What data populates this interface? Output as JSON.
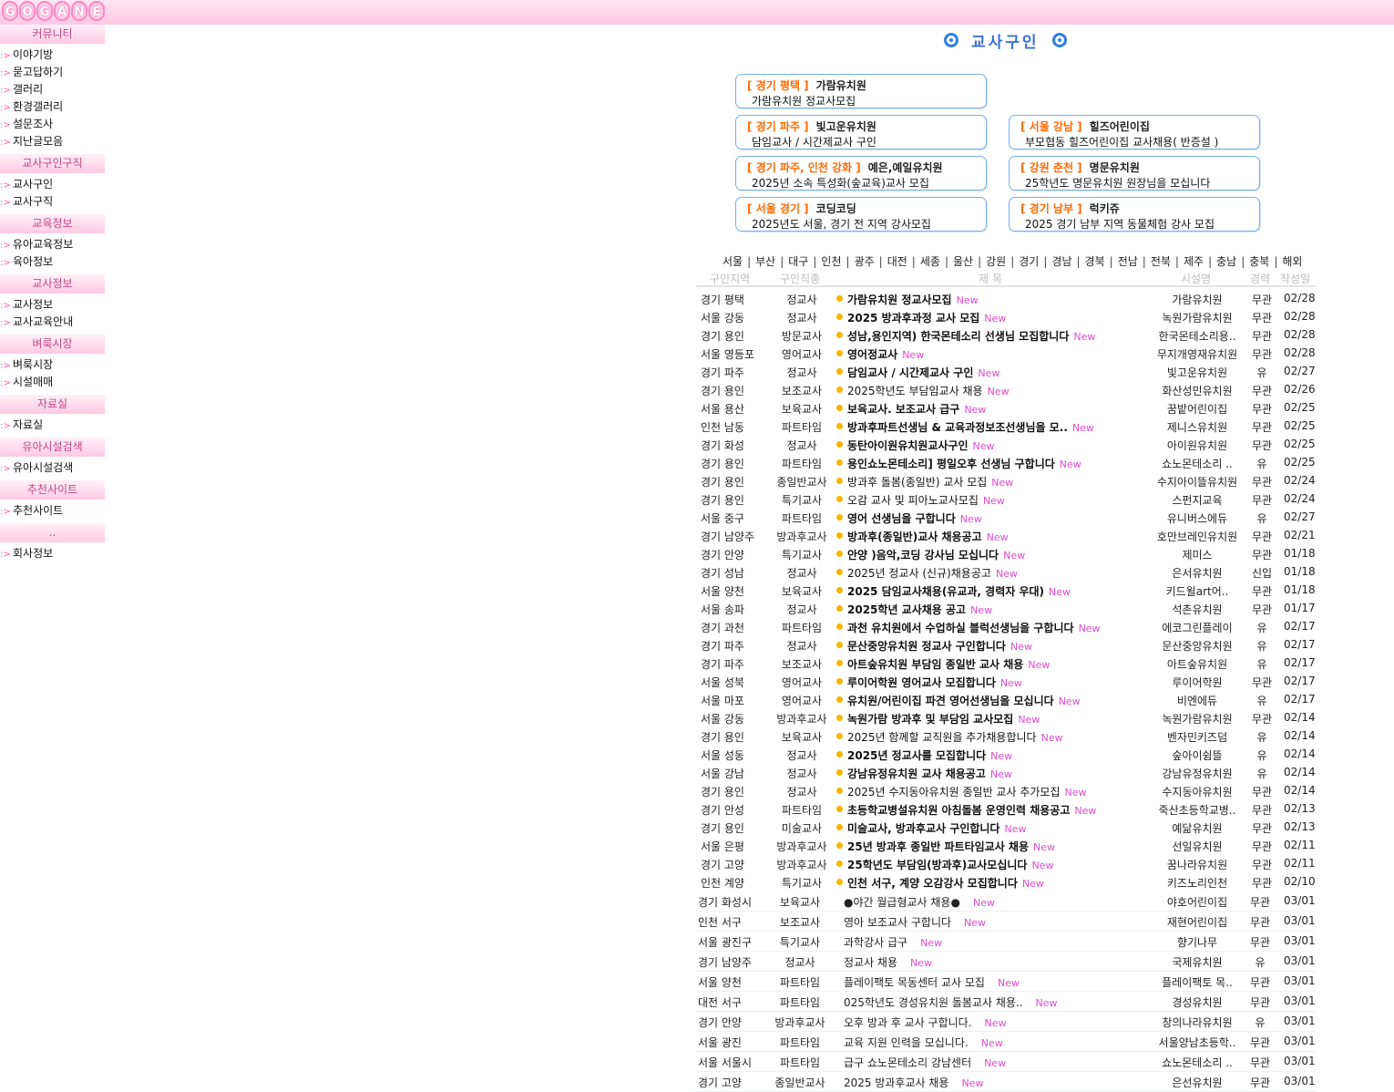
{
  "logo": {
    "letters": [
      "G",
      "O",
      "G",
      "A",
      "N",
      "E"
    ]
  },
  "sidebar": {
    "sections": [
      {
        "title": "커뮤니티",
        "items": [
          "이야기방",
          "묻고답하기",
          "갤러리",
          "환경갤러리",
          "설문조사",
          "지난글모음"
        ]
      },
      {
        "title": "교사구인구직",
        "items": [
          "교사구인",
          "교사구직"
        ]
      },
      {
        "title": "교육정보",
        "items": [
          "유아교육정보",
          "육아정보"
        ]
      },
      {
        "title": "교사정보",
        "items": [
          "교사정보",
          "교사교육안내"
        ]
      },
      {
        "title": "벼룩시장",
        "items": [
          "벼룩시장",
          "시설매매"
        ]
      },
      {
        "title": "자료실",
        "items": [
          "자료실"
        ]
      },
      {
        "title": "유아시설검색",
        "items": [
          "유아시설검색"
        ]
      },
      {
        "title": "추천사이트",
        "items": [
          "추천사이트"
        ]
      },
      {
        "title": "..",
        "items": [
          "회사정보"
        ]
      }
    ],
    "arrow": ":>"
  },
  "board": {
    "title": "교사구인"
  },
  "featured": [
    {
      "region": "[ 경기 평택 ]",
      "name": "가람유치원",
      "desc": "가람유치원 정교사모집"
    },
    {
      "region": "[ 경기 파주 ]",
      "name": "빛고운유치원",
      "desc": "담임교사 / 시간제교사 구인"
    },
    {
      "region": "[ 서울 강남 ]",
      "name": "힐즈어린이집",
      "desc": "부모협동 힐즈어린이집 교사채용( 반증설 )"
    },
    {
      "region": "[ 경기 파주, 인천 강화 ]",
      "name": "예은,예일유치원",
      "desc": "2025년 소속 특성화(숲교육)교사 모집"
    },
    {
      "region": "[ 강원 춘천 ]",
      "name": "명문유치원",
      "desc": "25학년도 명문유치원 원장님을 모십니다"
    },
    {
      "region": "[ 서울 경기 ]",
      "name": "코딩코딩",
      "desc": "2025년도 서울, 경기 전 지역 강사모집"
    },
    {
      "region": "[ 경기 남부 ]",
      "name": "럭키쥬",
      "desc": "2025 경기 남부 지역 동물체험 강사 모집"
    }
  ],
  "regions": [
    "서울",
    "부산",
    "대구",
    "인천",
    "광주",
    "대전",
    "세종",
    "울산",
    "강원",
    "경기",
    "경남",
    "경북",
    "전남",
    "전북",
    "제주",
    "충남",
    "충북",
    "해외"
  ],
  "columns": {
    "region": "구인지역",
    "type": "구인직종",
    "title": "제 목",
    "facility": "시설명",
    "career": "경력",
    "date": "작성일"
  },
  "new_label": "New",
  "premium_rows": [
    {
      "region": "경기 평택",
      "type": "정교사",
      "title": "가람유치원 정교사모집",
      "facility": "가람유치원",
      "career": "무관",
      "date": "02/28",
      "bold": true
    },
    {
      "region": "서울 강동",
      "type": "정교사",
      "title": "2025 방과후과정 교사 모집",
      "facility": "녹원가람유치원",
      "career": "무관",
      "date": "02/28",
      "bold": true
    },
    {
      "region": "경기 용인",
      "type": "방문교사",
      "title": "성남,용인지역) 한국몬테소리 선생님 모집합니다",
      "facility": "한국몬테소리용..",
      "career": "무관",
      "date": "02/28",
      "bold": true
    },
    {
      "region": "서울 영등포",
      "type": "영어교사",
      "title": "영어정교사",
      "facility": "무지개영재유치원",
      "career": "무관",
      "date": "02/28",
      "bold": true
    },
    {
      "region": "경기 파주",
      "type": "정교사",
      "title": "담임교사 / 시간제교사 구인",
      "facility": "빛고운유치원",
      "career": "유",
      "date": "02/27",
      "bold": true
    },
    {
      "region": "경기 용인",
      "type": "보조교사",
      "title": "2025학년도 부담임교사 채용",
      "facility": "화산성민유치원",
      "career": "무관",
      "date": "02/26",
      "bold": false
    },
    {
      "region": "서울 용산",
      "type": "보육교사",
      "title": "보육교사. 보조교사 급구",
      "facility": "꿈밭어린이집",
      "career": "무관",
      "date": "02/25",
      "bold": true
    },
    {
      "region": "인천 남동",
      "type": "파트타임",
      "title": "방과후파트선생님 & 교육과정보조선생님을 모..",
      "facility": "제니스유치원",
      "career": "무관",
      "date": "02/25",
      "bold": true
    },
    {
      "region": "경기 화성",
      "type": "정교사",
      "title": "동탄아이원유치원교사구인",
      "facility": "아이원유치원",
      "career": "무관",
      "date": "02/25",
      "bold": true
    },
    {
      "region": "경기 용인",
      "type": "파트타임",
      "title": "용인쇼노몬테소리] 평일오후 선생님 구합니다",
      "facility": "쇼노몬테소리 ..",
      "career": "유",
      "date": "02/25",
      "bold": true
    },
    {
      "region": "경기 용인",
      "type": "종일반교사",
      "title": "방과후 돌봄(종일반) 교사 모집",
      "facility": "수지아이뜰유치원",
      "career": "무관",
      "date": "02/24",
      "bold": false
    },
    {
      "region": "경기 용인",
      "type": "특기교사",
      "title": "오감 교사 및 피아노교사모집",
      "facility": "스펀지교육",
      "career": "무관",
      "date": "02/24",
      "bold": false
    },
    {
      "region": "서울 중구",
      "type": "파트타임",
      "title": "영어 선생님을 구합니다",
      "facility": "유니버스에듀",
      "career": "유",
      "date": "02/27",
      "bold": true
    },
    {
      "region": "경기 남양주",
      "type": "방과후교사",
      "title": "방과후(종일반)교사 채용공고",
      "facility": "호만브레인유치원",
      "career": "무관",
      "date": "02/21",
      "bold": true
    },
    {
      "region": "경기 안양",
      "type": "특기교사",
      "title": "안양 )음악,코딩 강사님 모십니다",
      "facility": "제미스",
      "career": "무관",
      "date": "01/18",
      "bold": true
    },
    {
      "region": "경기 성남",
      "type": "정교사",
      "title": "2025년 정교사 (신규)채용공고",
      "facility": "은서유치원",
      "career": "신입",
      "date": "01/18",
      "bold": false
    },
    {
      "region": "서울 양천",
      "type": "보육교사",
      "title": "2025 담임교사채용(유교과, 경력자 우대)",
      "facility": "키드윌art어..",
      "career": "무관",
      "date": "01/18",
      "bold": true
    },
    {
      "region": "서울 송파",
      "type": "정교사",
      "title": "2025학년 교사채용 공고",
      "facility": "석촌유치원",
      "career": "무관",
      "date": "01/17",
      "bold": true
    },
    {
      "region": "경기 과천",
      "type": "파트타임",
      "title": "과천 유치원에서 수업하실 블럭선생님을 구합니다",
      "facility": "에코그린플레이",
      "career": "유",
      "date": "02/17",
      "bold": true
    },
    {
      "region": "경기 파주",
      "type": "정교사",
      "title": "문산중앙유치원 정교사 구인합니다",
      "facility": "문산중앙유치원",
      "career": "유",
      "date": "02/17",
      "bold": true
    },
    {
      "region": "경기 파주",
      "type": "보조교사",
      "title": "아트숲유치원 부담임 종일반 교사 채용",
      "facility": "아트숲유치원",
      "career": "유",
      "date": "02/17",
      "bold": true
    },
    {
      "region": "서울 성북",
      "type": "영어교사",
      "title": "루이어학원 영어교사 모집합니다",
      "facility": "루이어학원",
      "career": "무관",
      "date": "02/17",
      "bold": true
    },
    {
      "region": "서울 마포",
      "type": "영어교사",
      "title": "유치원/어린이집 파견 영어선생님을 모십니다",
      "facility": "비엔에듀",
      "career": "유",
      "date": "02/17",
      "bold": true
    },
    {
      "region": "서울 강동",
      "type": "방과후교사",
      "title": "녹원가람 방과후 및 부담임 교사모집",
      "facility": "녹원가람유치원",
      "career": "무관",
      "date": "02/14",
      "bold": true
    },
    {
      "region": "경기 용인",
      "type": "보육교사",
      "title": "2025년 함께할 교직원을 추가채용합니다",
      "facility": "벤자민키즈덤",
      "career": "유",
      "date": "02/14",
      "bold": false
    },
    {
      "region": "서울 성동",
      "type": "정교사",
      "title": "2025년 정교사를 모집합니다",
      "facility": "숲아이쉼뜰",
      "career": "유",
      "date": "02/14",
      "bold": true
    },
    {
      "region": "서울 강남",
      "type": "정교사",
      "title": "강남유정유치원 교사 채용공고",
      "facility": "강남유정유치원",
      "career": "유",
      "date": "02/14",
      "bold": true
    },
    {
      "region": "경기 용인",
      "type": "정교사",
      "title": "2025년 수지동아유치원 종일반 교사 추가모집",
      "facility": "수지동아유치원",
      "career": "무관",
      "date": "02/14",
      "bold": false
    },
    {
      "region": "경기 안성",
      "type": "파트타임",
      "title": "초등학교병설유치원 아침돌봄 운영인력 채용공고",
      "facility": "죽산초등학교병..",
      "career": "무관",
      "date": "02/13",
      "bold": true
    },
    {
      "region": "경기 용인",
      "type": "미술교사",
      "title": "미술교사, 방과후교사 구인합니다",
      "facility": "예닮유치원",
      "career": "무관",
      "date": "02/13",
      "bold": true
    },
    {
      "region": "서울 은평",
      "type": "방과후교사",
      "title": "25년 방과후 종일반 파트타임교사 채용",
      "facility": "선일유치원",
      "career": "무관",
      "date": "02/11",
      "bold": true
    },
    {
      "region": "경기 고양",
      "type": "방과후교사",
      "title": "25학년도 부담임(방과후)교사모십니다",
      "facility": "꿈나라유치원",
      "career": "무관",
      "date": "02/11",
      "bold": true
    },
    {
      "region": "인천 계양",
      "type": "특기교사",
      "title": "인천 서구, 계양 오감강사 모집합니다",
      "facility": "키즈노리인천",
      "career": "무관",
      "date": "02/10",
      "bold": true
    }
  ],
  "normal_rows": [
    {
      "region": "경기 화성시",
      "type": "보육교사",
      "title": "●야간 월급형교사 채용●",
      "facility": "야호어린이집",
      "career": "무관",
      "date": "03/01"
    },
    {
      "region": "인천 서구",
      "type": "보조교사",
      "title": "영아 보조교사 구합니다",
      "facility": "재현어린이집",
      "career": "무관",
      "date": "03/01"
    },
    {
      "region": "서울 광진구",
      "type": "특기교사",
      "title": "과학강사 급구",
      "facility": "향기나무",
      "career": "무관",
      "date": "03/01"
    },
    {
      "region": "경기 남양주",
      "type": "정교사",
      "title": "정교사 채용",
      "facility": "국제유치원",
      "career": "유",
      "date": "03/01"
    },
    {
      "region": "서울 양천",
      "type": "파트타임",
      "title": "플레이팩토 목동센터 교사 모집",
      "facility": "플레이팩토 목..",
      "career": "무관",
      "date": "03/01"
    },
    {
      "region": "대전 서구",
      "type": "파트타임",
      "title": "025학년도 경성유치원 돌봄교사 채용..",
      "facility": "경성유치원",
      "career": "무관",
      "date": "03/01"
    },
    {
      "region": "경기 안양",
      "type": "방과후교사",
      "title": "오후 방과 후 교사 구합니다.",
      "facility": "창의나라유치원",
      "career": "유",
      "date": "03/01"
    },
    {
      "region": "서울 광진",
      "type": "파트타임",
      "title": "교육 지원 인력을 모십니다.",
      "facility": "서울양남초등학..",
      "career": "무관",
      "date": "03/01"
    },
    {
      "region": "서울 서울시",
      "type": "파트타임",
      "title": "급구 쇼노몬테소리 강남센터",
      "facility": "쇼노몬테소리 ..",
      "career": "무관",
      "date": "03/01"
    },
    {
      "region": "경기 고양",
      "type": "종일반교사",
      "title": "2025 방과후교사 채용",
      "facility": "은선유치원",
      "career": "무관",
      "date": "03/01"
    }
  ]
}
